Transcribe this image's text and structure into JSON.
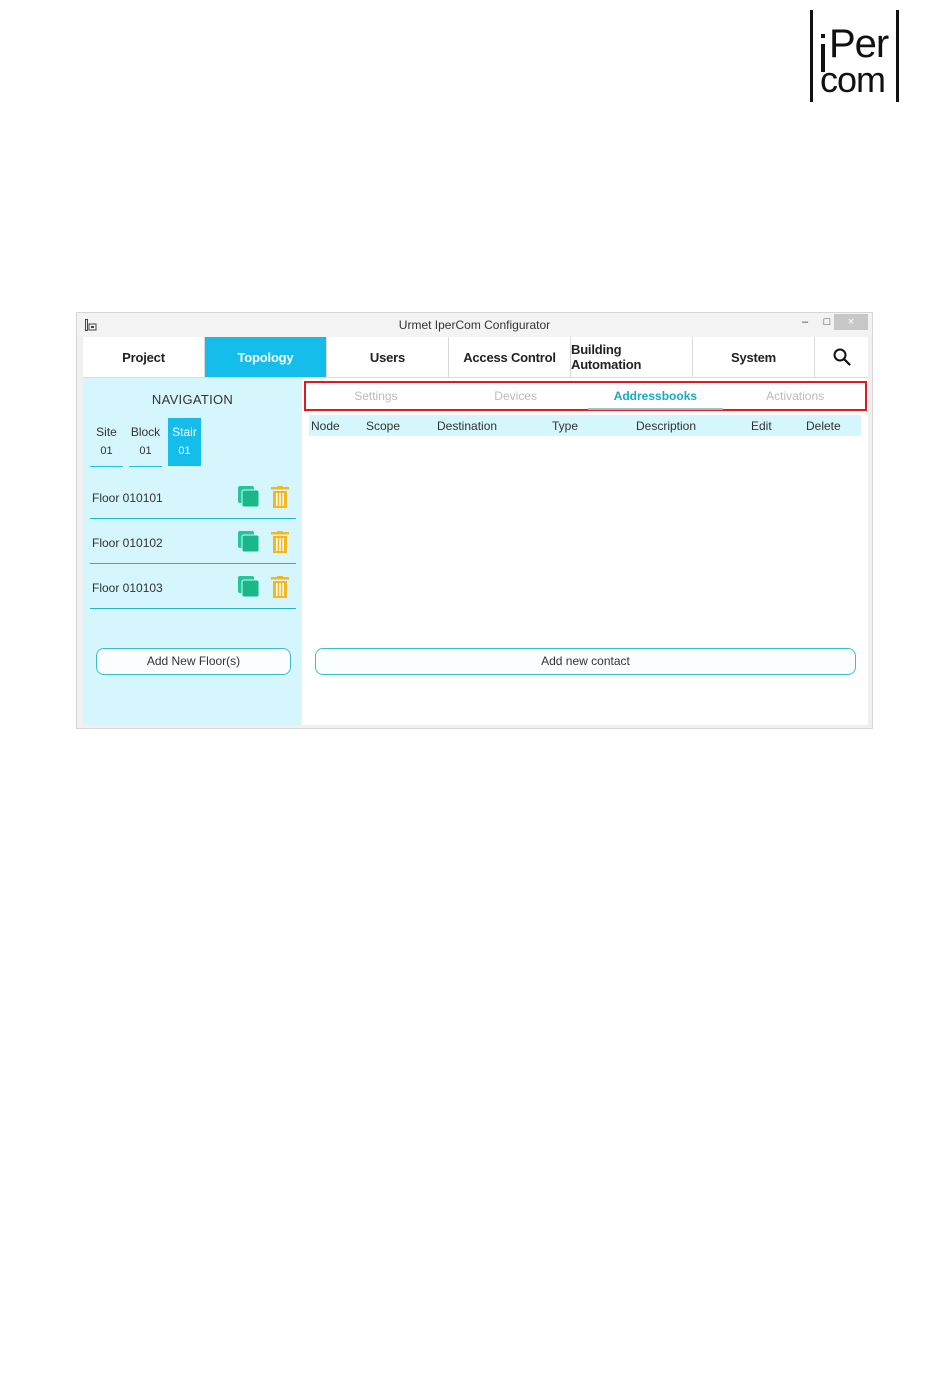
{
  "brand": {
    "logo_text_top": "Per",
    "logo_text_bottom": "com"
  },
  "window": {
    "title": "Urmet IperCom Configurator",
    "controls": {
      "minimize": "–",
      "maximize": "□",
      "close": "×"
    }
  },
  "menu": {
    "items": [
      {
        "label": "Project",
        "active": false
      },
      {
        "label": "Topology",
        "active": true
      },
      {
        "label": "Users",
        "active": false
      },
      {
        "label": "Access Control",
        "active": false
      },
      {
        "label": "Building Automation",
        "active": false
      },
      {
        "label": "System",
        "active": false
      }
    ],
    "search_icon": "search-icon"
  },
  "navigation": {
    "title": "NAVIGATION",
    "location": {
      "site": {
        "label": "Site",
        "value": "01"
      },
      "block": {
        "label": "Block",
        "value": "01"
      },
      "stair": {
        "label": "Stair",
        "value": "01"
      }
    },
    "floors": [
      {
        "name": "Floor 010101"
      },
      {
        "name": "Floor 010102"
      },
      {
        "name": "Floor 010103"
      }
    ],
    "add_floor_label": "Add New Floor(s)"
  },
  "subtabs": [
    {
      "label": "Settings",
      "active": false
    },
    {
      "label": "Devices",
      "active": false
    },
    {
      "label": "Addressbooks",
      "active": true
    },
    {
      "label": "Activations",
      "active": false
    }
  ],
  "table": {
    "columns": [
      "Node",
      "Scope",
      "Destination",
      "Type",
      "Description",
      "Edit",
      "Delete"
    ],
    "rows": []
  },
  "add_contact_label": "Add new contact",
  "colors": {
    "accent": "#15bdea",
    "panel": "#d4f6fc",
    "highlight_border": "#e01a22",
    "copy_icon": "#1fc79a",
    "delete_icon": "#f3b81f"
  }
}
